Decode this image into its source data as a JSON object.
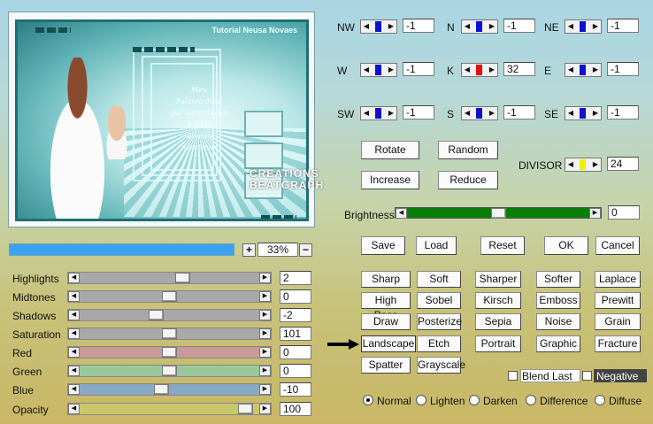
{
  "preview": {
    "tutorial_text": "Tutorial Neusa Novaes",
    "poem_lines": [
      "Meu",
      "Palavra doce",
      "que aprendemos",
      "a falar",
      "-quando",
      "nascemos"
    ],
    "watermark": [
      "CREATIONS",
      "BEATGRAPH"
    ]
  },
  "zoom": {
    "plus": "+",
    "value": "33%",
    "minus": "−"
  },
  "sliders": [
    {
      "label": "Highlights",
      "value": "2",
      "color": "#a8a8a8",
      "pos": 0.58
    },
    {
      "label": "Midtones",
      "value": "0",
      "color": "#a8a8a8",
      "pos": 0.5
    },
    {
      "label": "Shadows",
      "value": "-2",
      "color": "#a8a8a8",
      "pos": 0.42
    },
    {
      "label": "Saturation",
      "value": "101",
      "color": "#a8a8a8",
      "pos": 0.5
    },
    {
      "label": "Red",
      "value": "0",
      "color": "#c89a98",
      "pos": 0.5
    },
    {
      "label": "Green",
      "value": "0",
      "color": "#9ac89a",
      "pos": 0.5
    },
    {
      "label": "Blue",
      "value": "-10",
      "color": "#88a8c4",
      "pos": 0.45
    },
    {
      "label": "Opacity",
      "value": "100",
      "color": "#c8c86a",
      "pos": 0.97
    }
  ],
  "matrix": [
    {
      "label": "NW",
      "value": "-1",
      "color": "#1010d0"
    },
    {
      "label": "N",
      "value": "-1",
      "color": "#1010d0"
    },
    {
      "label": "NE",
      "value": "-1",
      "color": "#1010d0"
    },
    {
      "label": "W",
      "value": "-1",
      "color": "#1010d0"
    },
    {
      "label": "K",
      "value": "32",
      "color": "#e01010"
    },
    {
      "label": "E",
      "value": "-1",
      "color": "#1010d0"
    },
    {
      "label": "SW",
      "value": "-1",
      "color": "#1010d0"
    },
    {
      "label": "S",
      "value": "-1",
      "color": "#1010d0"
    },
    {
      "label": "SE",
      "value": "-1",
      "color": "#1010d0"
    }
  ],
  "buttons": {
    "rotate": "Rotate",
    "random": "Random",
    "increase": "Increase",
    "reduce": "Reduce",
    "save": "Save",
    "load": "Load",
    "reset": "Reset",
    "ok": "OK",
    "cancel": "Cancel"
  },
  "divisor": {
    "label": "DIVISOR",
    "value": "24",
    "color": "#f0f000"
  },
  "brightness": {
    "label": "Brightness",
    "value": "0",
    "color": "#0a7d0a",
    "pos": 0.5
  },
  "presets": [
    [
      "Sharp",
      "Soft",
      "Sharper",
      "Softer",
      "Laplace"
    ],
    [
      "High Pass",
      "Sobel",
      "Kirsch",
      "Emboss",
      "Prewitt"
    ],
    [
      "Draw",
      "Posterize",
      "Sepia",
      "Noise",
      "Grain"
    ],
    [
      "Landscape",
      "Etch",
      "Portrait",
      "Graphic",
      "Fracture"
    ],
    [
      "Spatter",
      "Grayscale"
    ]
  ],
  "selected_preset": "Landscape",
  "options": {
    "blend_last": "Blend Last",
    "negative": "Negative"
  },
  "modes": [
    "Normal",
    "Lighten",
    "Darken",
    "Difference",
    "Diffuse"
  ],
  "selected_mode": "Normal"
}
